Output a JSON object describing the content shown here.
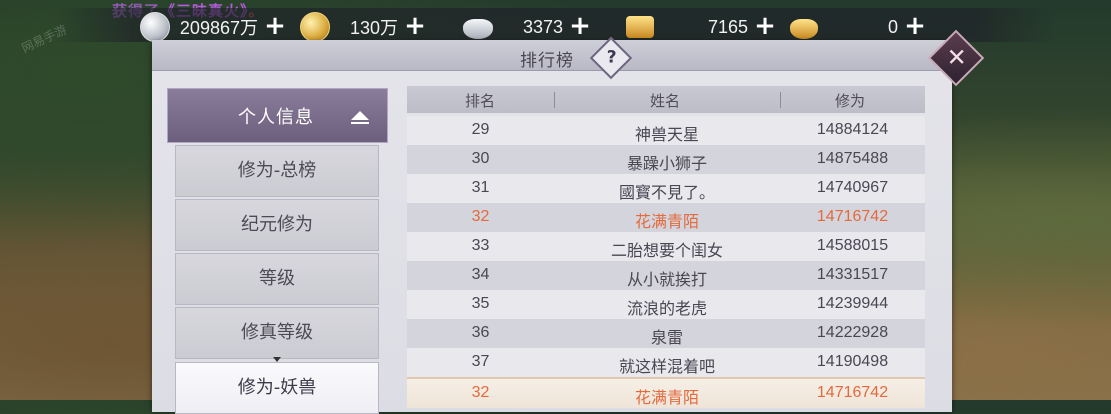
{
  "notice": {
    "prefix": "获得了",
    "item": "《三昧真火》",
    "dot": "。"
  },
  "resources": [
    {
      "icon": "silver-coin-icon",
      "value": "209867万"
    },
    {
      "icon": "gold-coin-icon",
      "value": "130万"
    },
    {
      "icon": "silver-ingot-icon",
      "value": "3373"
    },
    {
      "icon": "gold-ingot-icon",
      "value": "7165"
    },
    {
      "icon": "gold-ingot-small-icon",
      "value": "0"
    }
  ],
  "panel": {
    "title": "排行榜",
    "help": "?",
    "close": "✕"
  },
  "menu": {
    "header": "个人信息",
    "items": [
      "修为-总榜",
      "纪元修为",
      "等级",
      "修真等级",
      "修为-妖兽"
    ]
  },
  "table": {
    "columns": [
      "排名",
      "姓名",
      "修为"
    ],
    "rows": [
      {
        "rank": "29",
        "name": "神兽天星",
        "score": "14884124"
      },
      {
        "rank": "30",
        "name": "暴躁小狮子",
        "score": "14875488"
      },
      {
        "rank": "31",
        "name": "國寳不見了。",
        "score": "14740967"
      },
      {
        "rank": "32",
        "name": "花满青陌",
        "score": "14716742"
      },
      {
        "rank": "33",
        "name": "二胎想要个闺女",
        "score": "14588015"
      },
      {
        "rank": "34",
        "name": "从小就挨打",
        "score": "14331517"
      },
      {
        "rank": "35",
        "name": "流浪的老虎",
        "score": "14239944"
      },
      {
        "rank": "36",
        "name": "泉雷",
        "score": "14222928"
      },
      {
        "rank": "37",
        "name": "就这样混着吧",
        "score": "14190498"
      }
    ],
    "mine": {
      "rank": "32",
      "name": "花满青陌",
      "score": "14716742"
    }
  },
  "colors": {
    "highlight": "#e36a3c",
    "menu_active": "#6c5f7e"
  }
}
